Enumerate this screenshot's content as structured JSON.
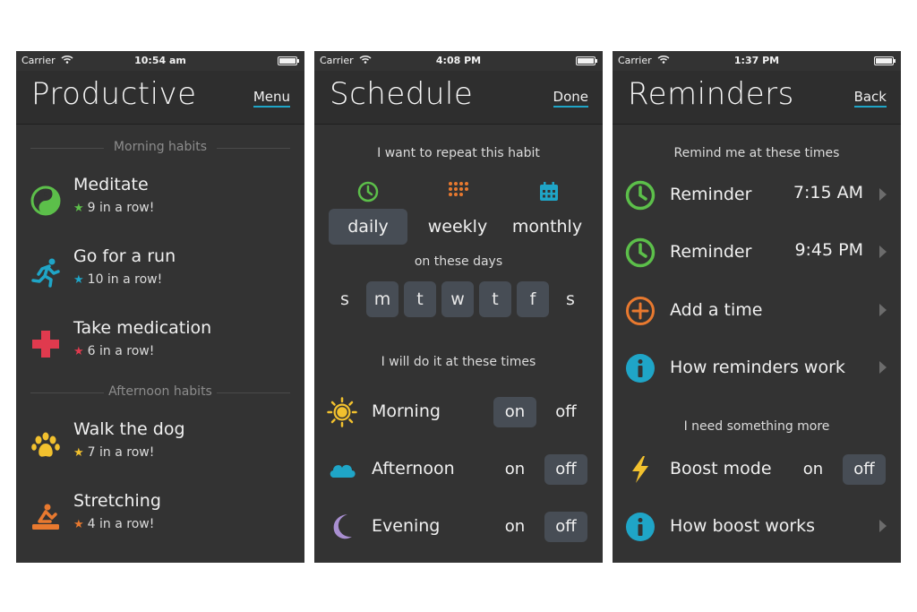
{
  "colors": {
    "background": "#ffffff",
    "screen": "#333333",
    "accent": "#1fa5c7",
    "selected": "#474d55",
    "green": "#5cbf4a",
    "teal": "#1fa5c7",
    "red": "#e03a4e",
    "yellow": "#f2c12e",
    "orange": "#e8792f",
    "lavender": "#a98fd1"
  },
  "screens": {
    "productive": {
      "status": {
        "carrier": "Carrier",
        "time": "10:54 am"
      },
      "title": "Productive",
      "nav_button": "Menu",
      "sections": [
        {
          "label": "Morning habits"
        },
        {
          "label": "Afternoon habits"
        }
      ],
      "habits": [
        {
          "name": "Meditate",
          "streak": "9 in a row!",
          "icon": "yin-yang-icon",
          "color": "#5cbf4a"
        },
        {
          "name": "Go for a run",
          "streak": "10 in a row!",
          "icon": "runner-icon",
          "color": "#1fa5c7"
        },
        {
          "name": "Take medication",
          "streak": "6 in a row!",
          "icon": "medical-cross-icon",
          "color": "#e03a4e"
        },
        {
          "name": "Walk the dog",
          "streak": "7 in a row!",
          "icon": "paw-icon",
          "color": "#f2c12e"
        },
        {
          "name": "Stretching",
          "streak": "4 in a row!",
          "icon": "stretching-icon",
          "color": "#e8792f"
        }
      ],
      "star_glyph": "★"
    },
    "schedule": {
      "status": {
        "carrier": "Carrier",
        "time": "4:08 PM"
      },
      "title": "Schedule",
      "nav_button": "Done",
      "repeat_label": "I want to repeat this habit",
      "frequencies": [
        {
          "label": "daily",
          "icon": "clock-icon",
          "selected": true
        },
        {
          "label": "weekly",
          "icon": "dots-grid-icon",
          "selected": false
        },
        {
          "label": "monthly",
          "icon": "calendar-icon",
          "selected": false
        }
      ],
      "days_label": "on these days",
      "days": [
        {
          "label": "s",
          "selected": false
        },
        {
          "label": "m",
          "selected": true
        },
        {
          "label": "t",
          "selected": true
        },
        {
          "label": "w",
          "selected": true
        },
        {
          "label": "t",
          "selected": true
        },
        {
          "label": "f",
          "selected": true
        },
        {
          "label": "s",
          "selected": false
        }
      ],
      "times_label": "I will do it at these times",
      "times": [
        {
          "label": "Morning",
          "icon": "sun-icon",
          "on": "on",
          "off": "off",
          "state": "on"
        },
        {
          "label": "Afternoon",
          "icon": "cloud-icon",
          "on": "on",
          "off": "off",
          "state": "off"
        },
        {
          "label": "Evening",
          "icon": "moon-icon",
          "on": "on",
          "off": "off",
          "state": "off"
        }
      ]
    },
    "reminders": {
      "status": {
        "carrier": "Carrier",
        "time": "1:37 PM"
      },
      "title": "Reminders",
      "nav_button": "Back",
      "remind_label": "Remind me at these times",
      "items": [
        {
          "label": "Reminder",
          "value": "7:15 AM",
          "icon": "clock-icon"
        },
        {
          "label": "Reminder",
          "value": "9:45 PM",
          "icon": "clock-icon"
        },
        {
          "label": "Add a time",
          "value": "",
          "icon": "plus-circle-icon"
        },
        {
          "label": "How reminders work",
          "value": "",
          "icon": "info-icon"
        }
      ],
      "more_label": "I need something more",
      "boost": {
        "label": "Boost mode",
        "on": "on",
        "off": "off",
        "state": "off",
        "icon": "lightning-icon"
      },
      "boost_info": {
        "label": "How boost works",
        "icon": "info-icon"
      }
    }
  }
}
